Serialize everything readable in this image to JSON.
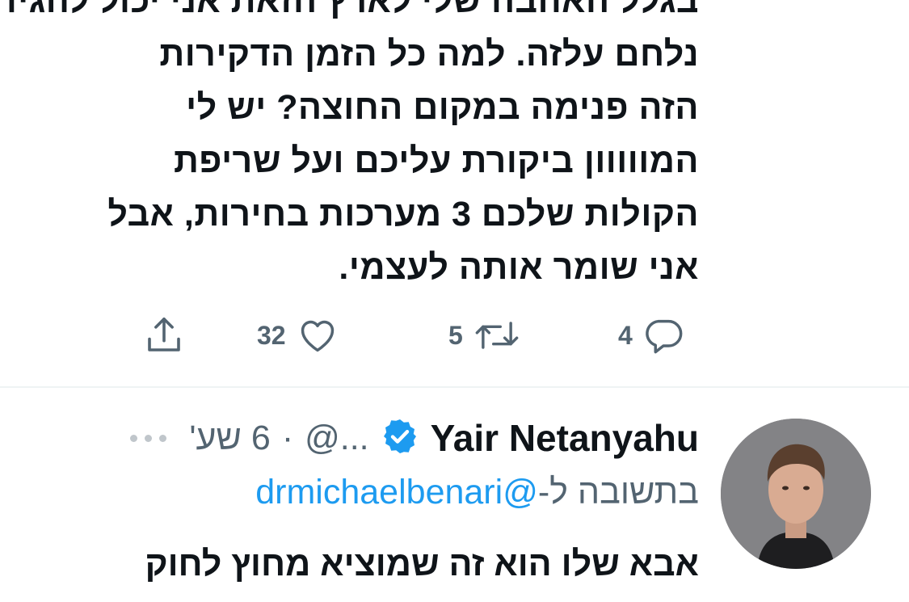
{
  "tweet": {
    "lines": [
      "בגלל האהבה שלי לארץ הזאת אני יכול להגיד",
      "נלחם עלזה. למה כל הזמן הדקירות",
      "הזה פנימה במקום החוצה? יש לי",
      "המווווון ביקורת עליכם ועל שריפת",
      "הקולות שלכם 3 מערכות בחירות, אבל",
      "אני שומר אותה לעצמי."
    ],
    "actions": {
      "reply_count": "4",
      "retweet_count": "5",
      "like_count": "32"
    }
  },
  "reply_tweet": {
    "display_name": "Yair Netanyahu",
    "handle": "@...",
    "separator": "·",
    "time": "6 שע'",
    "reply_prefix": "בתשובה ל-",
    "reply_mention": "@drmichaelbenari",
    "text_cutoff": "אבא שלו הוא זה שמוציא מחוץ לחוק"
  },
  "colors": {
    "link": "#1d9bf0",
    "secondary_text": "#536471",
    "verified": "#1d9bf0"
  },
  "icons": [
    "reply-icon",
    "retweet-icon",
    "like-icon",
    "share-icon",
    "verified-badge-icon",
    "more-icon"
  ]
}
